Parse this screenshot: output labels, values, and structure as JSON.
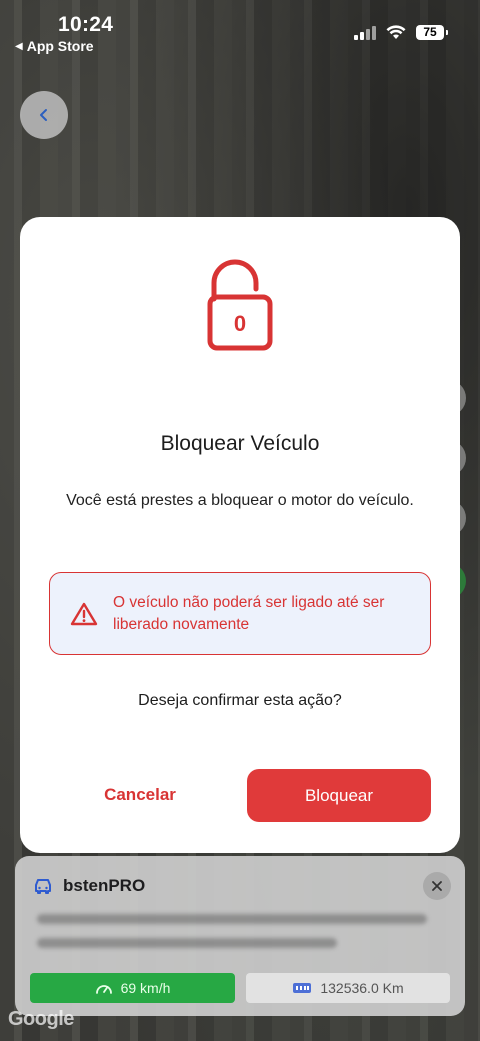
{
  "status_bar": {
    "time": "10:24",
    "back_app": "App Store",
    "battery": "75"
  },
  "navigation": {
    "back_icon": "chevron-left-icon"
  },
  "modal": {
    "icon": "unlocked-padlock-icon",
    "icon_glyph": "0",
    "title": "Bloquear Veículo",
    "message": "Você está prestes a bloquear o motor do veículo.",
    "warning": {
      "icon": "warning-triangle-icon",
      "text": "O veículo não poderá ser ligado até ser liberado novamente"
    },
    "question": "Deseja confirmar esta ação?",
    "cancel_label": "Cancelar",
    "confirm_label": "Bloquear"
  },
  "vehicle_card": {
    "icon": "car-icon",
    "title": "bstenPRO",
    "speed": "69 km/h",
    "odometer": "132536.0 Km"
  },
  "map": {
    "attribution": "Google"
  },
  "colors": {
    "accent": "#e03a3a",
    "warning_bg": "#edf2fc",
    "speed_green": "#27a844"
  }
}
